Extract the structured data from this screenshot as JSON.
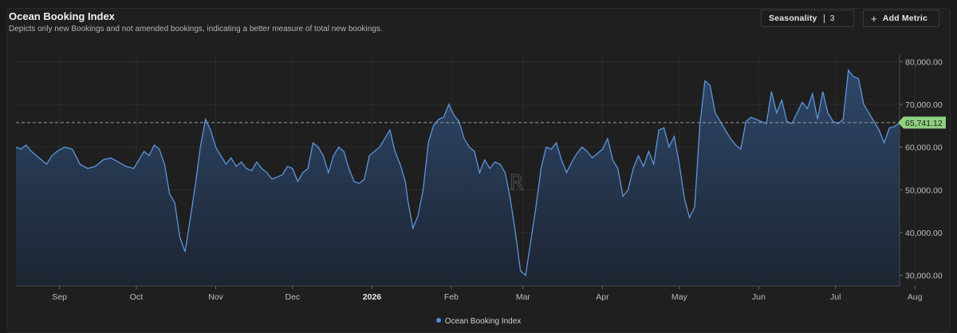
{
  "header": {
    "title": "Ocean Booking Index",
    "subtitle": "Depicts only new Bookings and not amended bookings, indicating a better measure of total new bookings."
  },
  "toolbar": {
    "seasonality_label": "Seasonality",
    "seasonality_value": "3",
    "add_metric_label": "Add Metric",
    "add_icon": "plus-icon"
  },
  "watermark": "SONAR",
  "legend": {
    "label": "Ocean Booking Index"
  },
  "colors": {
    "line": "#5b95dd",
    "fill_top": "#2f4a6e",
    "fill_bottom": "#1d2533",
    "last_value_badge": "#8ed081"
  },
  "chart_data": {
    "type": "area",
    "series": [
      {
        "name": "Ocean Booking Index",
        "last_value": "65,741.12"
      }
    ],
    "x_ticks": [
      "Sep",
      "Oct",
      "Nov",
      "Dec",
      "2026",
      "Feb",
      "Mar",
      "Apr",
      "May",
      "Jun",
      "Jul",
      "Aug"
    ],
    "y_ticks": [
      "80,000.00",
      "70,000.00",
      "60,000.00",
      "50,000.00",
      "40,000.00",
      "30,000.00"
    ],
    "ylim": [
      27500,
      81000
    ],
    "points": [
      [
        "2025-08-15",
        60000
      ],
      [
        "2025-08-17",
        59500
      ],
      [
        "2025-08-19",
        60500
      ],
      [
        "2025-08-21",
        59000
      ],
      [
        "2025-08-23",
        58000
      ],
      [
        "2025-08-25",
        57000
      ],
      [
        "2025-08-27",
        56000
      ],
      [
        "2025-08-29",
        58000
      ],
      [
        "2025-08-31",
        59000
      ],
      [
        "2025-09-03",
        60000
      ],
      [
        "2025-09-06",
        59500
      ],
      [
        "2025-09-09",
        56000
      ],
      [
        "2025-09-12",
        55000
      ],
      [
        "2025-09-15",
        55500
      ],
      [
        "2025-09-18",
        57000
      ],
      [
        "2025-09-21",
        57500
      ],
      [
        "2025-09-24",
        56500
      ],
      [
        "2025-09-27",
        55500
      ],
      [
        "2025-09-30",
        55000
      ],
      [
        "2025-10-02",
        57000
      ],
      [
        "2025-10-04",
        59000
      ],
      [
        "2025-10-06",
        58000
      ],
      [
        "2025-10-08",
        60500
      ],
      [
        "2025-10-10",
        59500
      ],
      [
        "2025-10-12",
        56000
      ],
      [
        "2025-10-14",
        49000
      ],
      [
        "2025-10-16",
        47000
      ],
      [
        "2025-10-18",
        39000
      ],
      [
        "2025-10-20",
        35500
      ],
      [
        "2025-10-22",
        43000
      ],
      [
        "2025-10-24",
        51000
      ],
      [
        "2025-10-26",
        60000
      ],
      [
        "2025-10-28",
        66500
      ],
      [
        "2025-10-30",
        64000
      ],
      [
        "2025-11-01",
        60000
      ],
      [
        "2025-11-03",
        58000
      ],
      [
        "2025-11-05",
        56000
      ],
      [
        "2025-11-07",
        57500
      ],
      [
        "2025-11-09",
        55500
      ],
      [
        "2025-11-11",
        56500
      ],
      [
        "2025-11-13",
        55000
      ],
      [
        "2025-11-15",
        54500
      ],
      [
        "2025-11-17",
        56500
      ],
      [
        "2025-11-19",
        55000
      ],
      [
        "2025-11-21",
        54000
      ],
      [
        "2025-11-23",
        52500
      ],
      [
        "2025-11-25",
        53000
      ],
      [
        "2025-11-27",
        53500
      ],
      [
        "2025-11-29",
        55500
      ],
      [
        "2025-12-01",
        55000
      ],
      [
        "2025-12-03",
        52000
      ],
      [
        "2025-12-05",
        54000
      ],
      [
        "2025-12-07",
        55000
      ],
      [
        "2025-12-09",
        61000
      ],
      [
        "2025-12-11",
        60000
      ],
      [
        "2025-12-13",
        58000
      ],
      [
        "2025-12-15",
        54000
      ],
      [
        "2025-12-17",
        58000
      ],
      [
        "2025-12-19",
        60000
      ],
      [
        "2025-12-21",
        59000
      ],
      [
        "2025-12-23",
        55000
      ],
      [
        "2025-12-25",
        52000
      ],
      [
        "2025-12-27",
        51500
      ],
      [
        "2025-12-29",
        52500
      ],
      [
        "2025-12-31",
        58000
      ],
      [
        "2026-01-02",
        59000
      ],
      [
        "2026-01-04",
        60000
      ],
      [
        "2026-01-06",
        62000
      ],
      [
        "2026-01-08",
        64000
      ],
      [
        "2026-01-10",
        59000
      ],
      [
        "2026-01-12",
        56000
      ],
      [
        "2026-01-14",
        52000
      ],
      [
        "2026-01-15",
        47500
      ],
      [
        "2026-01-17",
        41000
      ],
      [
        "2026-01-19",
        44000
      ],
      [
        "2026-01-21",
        50000
      ],
      [
        "2026-01-23",
        61000
      ],
      [
        "2026-01-25",
        65000
      ],
      [
        "2026-01-27",
        66500
      ],
      [
        "2026-01-29",
        67000
      ],
      [
        "2026-01-31",
        70000
      ],
      [
        "2026-02-02",
        67500
      ],
      [
        "2026-02-04",
        66000
      ],
      [
        "2026-02-06",
        62000
      ],
      [
        "2026-02-08",
        60000
      ],
      [
        "2026-02-10",
        59000
      ],
      [
        "2026-02-12",
        54000
      ],
      [
        "2026-02-14",
        57000
      ],
      [
        "2026-02-16",
        55000
      ],
      [
        "2026-02-18",
        56500
      ],
      [
        "2026-02-20",
        56000
      ],
      [
        "2026-02-22",
        54000
      ],
      [
        "2026-02-24",
        48000
      ],
      [
        "2026-02-26",
        40000
      ],
      [
        "2026-02-28",
        31000
      ],
      [
        "2026-03-02",
        30000
      ],
      [
        "2026-03-04",
        38000
      ],
      [
        "2026-03-06",
        46000
      ],
      [
        "2026-03-08",
        55000
      ],
      [
        "2026-03-10",
        60000
      ],
      [
        "2026-03-12",
        59500
      ],
      [
        "2026-03-14",
        61000
      ],
      [
        "2026-03-16",
        57000
      ],
      [
        "2026-03-18",
        54000
      ],
      [
        "2026-03-20",
        56500
      ],
      [
        "2026-03-22",
        58500
      ],
      [
        "2026-03-24",
        60000
      ],
      [
        "2026-03-26",
        59000
      ],
      [
        "2026-03-28",
        57500
      ],
      [
        "2026-03-30",
        58500
      ],
      [
        "2026-04-01",
        59500
      ],
      [
        "2026-04-03",
        62000
      ],
      [
        "2026-04-05",
        57000
      ],
      [
        "2026-04-07",
        55000
      ],
      [
        "2026-04-09",
        48500
      ],
      [
        "2026-04-11",
        50000
      ],
      [
        "2026-04-13",
        55000
      ],
      [
        "2026-04-15",
        58000
      ],
      [
        "2026-04-17",
        55500
      ],
      [
        "2026-04-19",
        59000
      ],
      [
        "2026-04-21",
        56000
      ],
      [
        "2026-04-23",
        64000
      ],
      [
        "2026-04-25",
        64500
      ],
      [
        "2026-04-27",
        60000
      ],
      [
        "2026-04-29",
        62500
      ],
      [
        "2026-05-01",
        56000
      ],
      [
        "2026-05-03",
        48000
      ],
      [
        "2026-05-05",
        43500
      ],
      [
        "2026-05-07",
        46000
      ],
      [
        "2026-05-09",
        65000
      ],
      [
        "2026-05-11",
        75500
      ],
      [
        "2026-05-13",
        74500
      ],
      [
        "2026-05-15",
        68000
      ],
      [
        "2026-05-17",
        66000
      ],
      [
        "2026-05-19",
        64000
      ],
      [
        "2026-05-21",
        62000
      ],
      [
        "2026-05-23",
        60500
      ],
      [
        "2026-05-25",
        59500
      ],
      [
        "2026-05-27",
        66000
      ],
      [
        "2026-05-29",
        67000
      ],
      [
        "2026-05-31",
        66500
      ],
      [
        "2026-06-02",
        66000
      ],
      [
        "2026-06-04",
        65500
      ],
      [
        "2026-06-06",
        73000
      ],
      [
        "2026-06-08",
        68000
      ],
      [
        "2026-06-10",
        71000
      ],
      [
        "2026-06-12",
        66000
      ],
      [
        "2026-06-14",
        65500
      ],
      [
        "2026-06-16",
        68000
      ],
      [
        "2026-06-18",
        70500
      ],
      [
        "2026-06-20",
        69000
      ],
      [
        "2026-06-22",
        72500
      ],
      [
        "2026-06-24",
        66500
      ],
      [
        "2026-06-26",
        73000
      ],
      [
        "2026-06-28",
        68000
      ],
      [
        "2026-06-30",
        66000
      ],
      [
        "2026-07-02",
        65500
      ],
      [
        "2026-07-04",
        66500
      ],
      [
        "2026-07-06",
        78000
      ],
      [
        "2026-07-08",
        76500
      ],
      [
        "2026-07-10",
        76000
      ],
      [
        "2026-07-12",
        70000
      ],
      [
        "2026-07-14",
        68000
      ],
      [
        "2026-07-16",
        66000
      ],
      [
        "2026-07-18",
        64000
      ],
      [
        "2026-07-20",
        61000
      ],
      [
        "2026-07-22",
        64500
      ],
      [
        "2026-07-24",
        64800
      ],
      [
        "2026-07-26",
        65741
      ]
    ]
  }
}
